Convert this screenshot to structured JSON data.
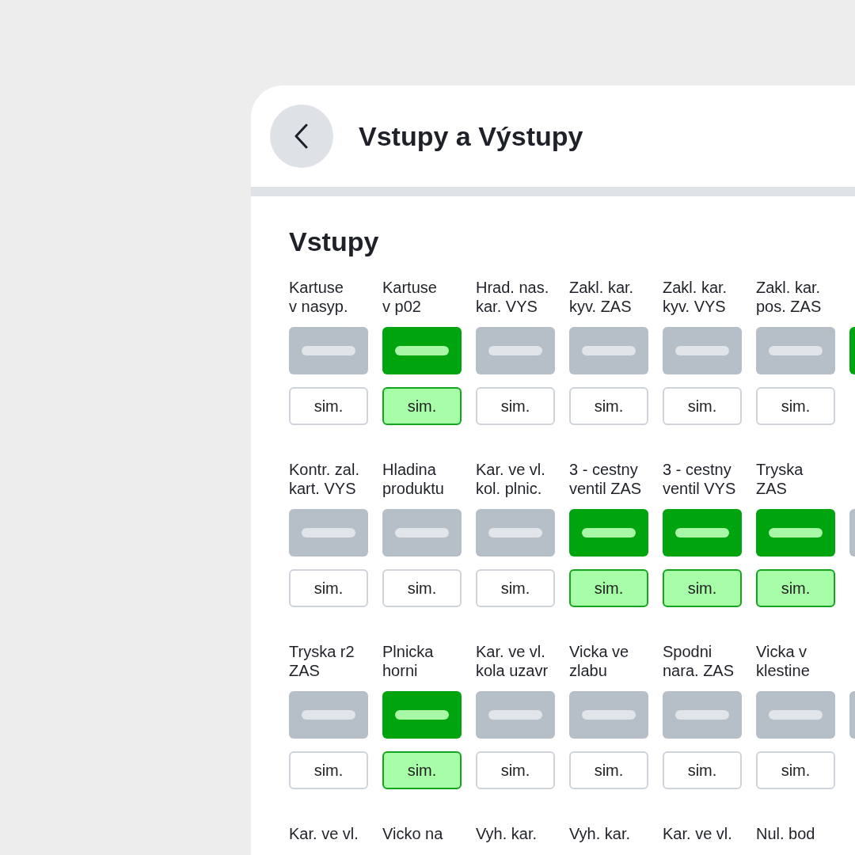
{
  "header": {
    "title": "Vstupy a Výstupy"
  },
  "section": {
    "title": "Vstupy",
    "rows": [
      {
        "items": [
          {
            "label": "Kartuse\nv nasyp.",
            "on": false,
            "button": "sim."
          },
          {
            "label": "Kartuse\nv p02",
            "on": true,
            "button": "sim."
          },
          {
            "label": "Hrad. nas.\nkar. VYS",
            "on": false,
            "button": "sim."
          },
          {
            "label": "Zakl. kar.\nkyv. ZAS",
            "on": false,
            "button": "sim."
          },
          {
            "label": "Zakl. kar.\nkyv. VYS",
            "on": false,
            "button": "sim."
          },
          {
            "label": "Zakl. kar.\npos. ZAS",
            "on": false,
            "button": "sim."
          },
          {
            "on": true
          }
        ]
      },
      {
        "items": [
          {
            "label": "Kontr. zal.\nkart. VYS",
            "on": false,
            "button": "sim."
          },
          {
            "label": "Hladina\nproduktu",
            "on": false,
            "button": "sim."
          },
          {
            "label": "Kar. ve vl.\nkol. plnic.",
            "on": false,
            "button": "sim."
          },
          {
            "label": "3 - cestny\nventil ZAS",
            "on": true,
            "button": "sim."
          },
          {
            "label": "3 - cestny\nventil VYS",
            "on": true,
            "button": "sim."
          },
          {
            "label": "Tryska\nZAS",
            "on": true,
            "button": "sim."
          },
          {
            "on": false
          }
        ]
      },
      {
        "items": [
          {
            "label": "Tryska r2\nZAS",
            "on": false,
            "button": "sim."
          },
          {
            "label": "Plnicka\nhorni",
            "on": true,
            "button": "sim."
          },
          {
            "label": "Kar. ve vl.\nkola uzavr",
            "on": false,
            "button": "sim."
          },
          {
            "label": "Vicka ve\nzlabu",
            "on": false,
            "button": "sim."
          },
          {
            "label": "Spodni\nnara. ZAS",
            "on": false,
            "button": "sim."
          },
          {
            "label": "Vicka v\nklestine",
            "on": false,
            "button": "sim."
          },
          {
            "on": false
          }
        ]
      },
      {
        "items": [
          {
            "label": "Kar. ve vl."
          },
          {
            "label": "Vicko na"
          },
          {
            "label": "Vyh. kar."
          },
          {
            "label": "Vyh. kar."
          },
          {
            "label": "Kar. ve vl."
          },
          {
            "label": "Nul. bod"
          }
        ]
      }
    ]
  }
}
